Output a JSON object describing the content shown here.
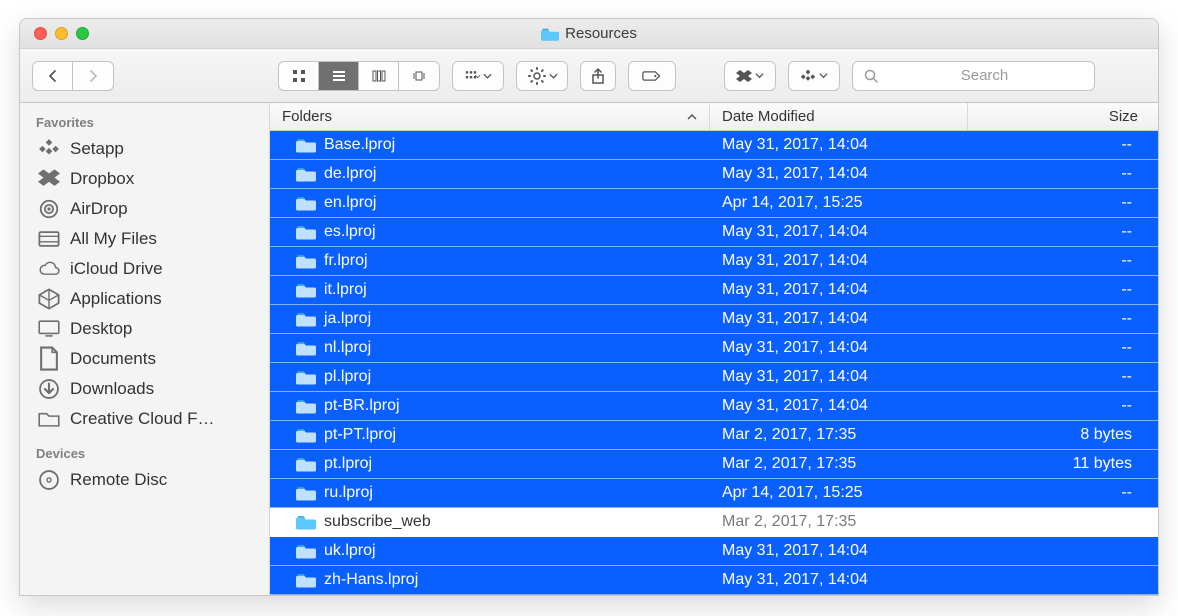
{
  "window": {
    "title": "Resources"
  },
  "search": {
    "placeholder": "Search"
  },
  "sidebar": {
    "sections": [
      {
        "label": "Favorites",
        "items": [
          {
            "label": "Setapp",
            "icon": "setapp-icon"
          },
          {
            "label": "Dropbox",
            "icon": "dropbox-icon"
          },
          {
            "label": "AirDrop",
            "icon": "airdrop-icon"
          },
          {
            "label": "All My Files",
            "icon": "all-my-files-icon"
          },
          {
            "label": "iCloud Drive",
            "icon": "icloud-icon"
          },
          {
            "label": "Applications",
            "icon": "applications-icon"
          },
          {
            "label": "Desktop",
            "icon": "desktop-icon"
          },
          {
            "label": "Documents",
            "icon": "documents-icon"
          },
          {
            "label": "Downloads",
            "icon": "downloads-icon"
          },
          {
            "label": "Creative Cloud F…",
            "icon": "folder-icon"
          }
        ]
      },
      {
        "label": "Devices",
        "items": [
          {
            "label": "Remote Disc",
            "icon": "disc-icon"
          }
        ]
      }
    ]
  },
  "columns": {
    "folders": "Folders",
    "date": "Date Modified",
    "size": "Size"
  },
  "files": [
    {
      "name": "Base.lproj",
      "date": "May 31, 2017, 14:04",
      "size": "--",
      "selected": true
    },
    {
      "name": "de.lproj",
      "date": "May 31, 2017, 14:04",
      "size": "--",
      "selected": true
    },
    {
      "name": "en.lproj",
      "date": "Apr 14, 2017, 15:25",
      "size": "--",
      "selected": true
    },
    {
      "name": "es.lproj",
      "date": "May 31, 2017, 14:04",
      "size": "--",
      "selected": true
    },
    {
      "name": "fr.lproj",
      "date": "May 31, 2017, 14:04",
      "size": "--",
      "selected": true
    },
    {
      "name": "it.lproj",
      "date": "May 31, 2017, 14:04",
      "size": "--",
      "selected": true
    },
    {
      "name": "ja.lproj",
      "date": "May 31, 2017, 14:04",
      "size": "--",
      "selected": true
    },
    {
      "name": "nl.lproj",
      "date": "May 31, 2017, 14:04",
      "size": "--",
      "selected": true
    },
    {
      "name": "pl.lproj",
      "date": "May 31, 2017, 14:04",
      "size": "--",
      "selected": true
    },
    {
      "name": "pt-BR.lproj",
      "date": "May 31, 2017, 14:04",
      "size": "--",
      "selected": true
    },
    {
      "name": "pt-PT.lproj",
      "date": "Mar 2, 2017, 17:35",
      "size": "8 bytes",
      "selected": true
    },
    {
      "name": "pt.lproj",
      "date": "Mar 2, 2017, 17:35",
      "size": "11 bytes",
      "selected": true
    },
    {
      "name": "ru.lproj",
      "date": "Apr 14, 2017, 15:25",
      "size": "--",
      "selected": true
    },
    {
      "name": "subscribe_web",
      "date": "Mar 2, 2017, 17:35",
      "size": "",
      "selected": false
    },
    {
      "name": "uk.lproj",
      "date": "May 31, 2017, 14:04",
      "size": "",
      "selected": true
    },
    {
      "name": "zh-Hans.lproj",
      "date": "May 31, 2017, 14:04",
      "size": "",
      "selected": true
    }
  ]
}
